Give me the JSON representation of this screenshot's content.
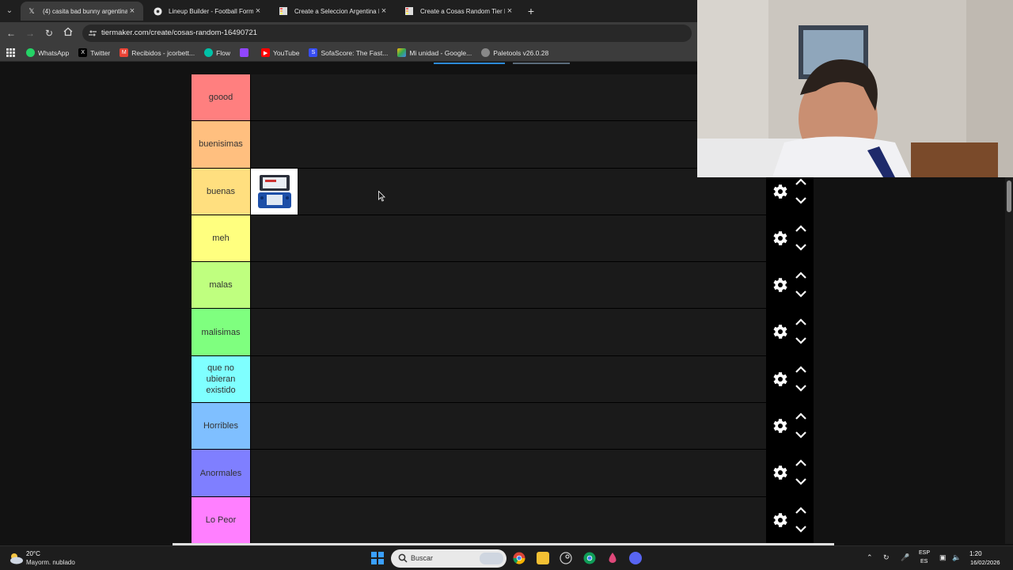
{
  "browser": {
    "tabs": [
      {
        "title": "(4) casita bad bunny argentina",
        "icon": "x-logo-icon"
      },
      {
        "title": "Lineup Builder - Football Forma",
        "icon": "football-icon"
      },
      {
        "title": "Create a Seleccion Argentina M",
        "icon": "tiermaker-icon"
      },
      {
        "title": "Create a Cosas Random Tier Li",
        "icon": "tiermaker-icon"
      }
    ],
    "url": "tiermaker.com/create/cosas-random-16490721",
    "bookmarks": [
      {
        "label": "WhatsApp",
        "icon": "whatsapp-icon",
        "color": "#25d366"
      },
      {
        "label": "Twitter",
        "icon": "x-logo-icon",
        "color": "#000000"
      },
      {
        "label": "Recibidos - jcorbett...",
        "icon": "gmail-icon",
        "color": "#ea4335"
      },
      {
        "label": "Flow",
        "icon": "flow-icon",
        "color": "#00c2a8"
      },
      {
        "label": "",
        "icon": "twitch-icon",
        "color": "#9146ff"
      },
      {
        "label": "YouTube",
        "icon": "youtube-icon",
        "color": "#ff0000"
      },
      {
        "label": "SofaScore: The Fast...",
        "icon": "sofascore-icon",
        "color": "#374df5"
      },
      {
        "label": "Mi unidad - Google...",
        "icon": "drive-icon",
        "color": "#fbbc04"
      },
      {
        "label": "Paletools v26.0.28",
        "icon": "paletools-icon",
        "color": "#888888"
      }
    ]
  },
  "tiers": [
    {
      "label": "goood",
      "color": "#ff7f7f"
    },
    {
      "label": "buenisimas",
      "color": "#ffbf7f"
    },
    {
      "label": "buenas",
      "color": "#ffdf7f"
    },
    {
      "label": "meh",
      "color": "#ffff7f"
    },
    {
      "label": "malas",
      "color": "#bfff7f"
    },
    {
      "label": "malisimas",
      "color": "#7fff7f"
    },
    {
      "label": "que no ubieran existido",
      "color": "#7fffff"
    },
    {
      "label": "Horribles",
      "color": "#7fbfff"
    },
    {
      "label": "Anormales",
      "color": "#7f7fff"
    },
    {
      "label": "Lo Peor",
      "color": "#ff7fff"
    }
  ],
  "placed_item": {
    "tier": "buenas",
    "name": "nintendo-3ds-image"
  },
  "taskbar": {
    "weather_temp": "20°C",
    "weather_desc": "Mayorm. nublado",
    "search_label": "Buscar",
    "lang_primary": "ESP",
    "lang_secondary": "ES",
    "time": "1:20",
    "date": "16/02/2026"
  }
}
